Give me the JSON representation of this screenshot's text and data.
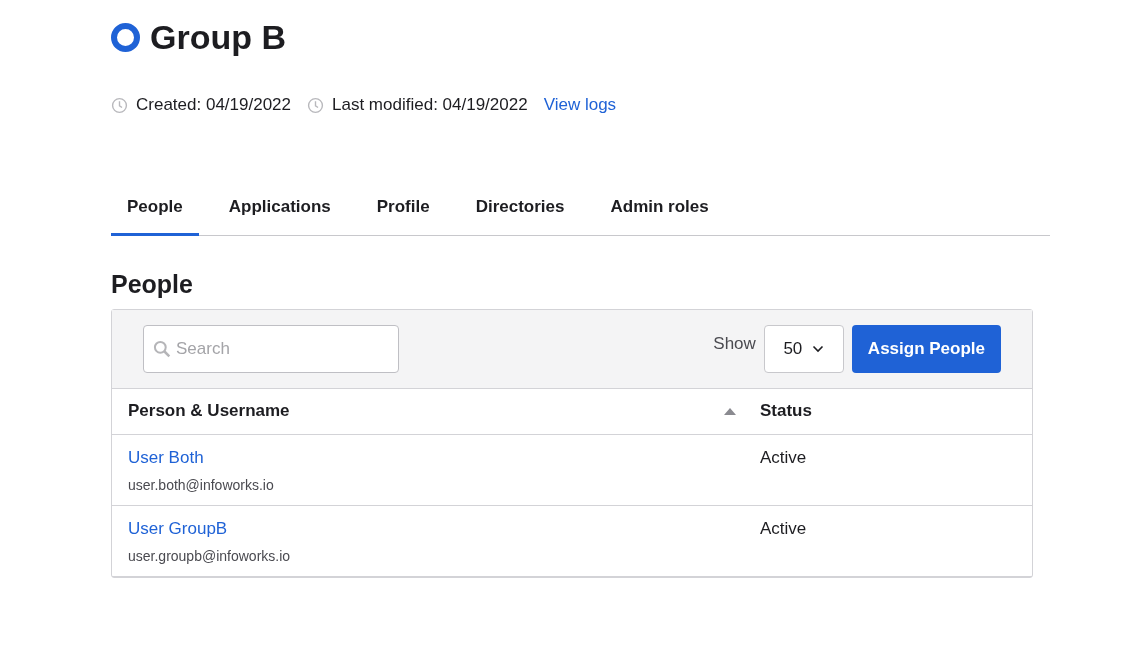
{
  "group": {
    "title": "Group B",
    "created": "Created: 04/19/2022",
    "modified": "Last modified: 04/19/2022",
    "logs_link": "View logs"
  },
  "tabs": [
    {
      "label": "People",
      "selected": true
    },
    {
      "label": "Applications",
      "selected": false
    },
    {
      "label": "Profile",
      "selected": false
    },
    {
      "label": "Directories",
      "selected": false
    },
    {
      "label": "Admin roles",
      "selected": false
    }
  ],
  "section_title": "People",
  "toolbar": {
    "search": {
      "placeholder": "Search"
    },
    "show_label": "Show",
    "page_size": "50",
    "assign_button": "Assign People"
  },
  "table": {
    "columns": [
      {
        "label": "Person & Username",
        "sorted": true
      },
      {
        "label": "Status",
        "sorted": false
      }
    ],
    "rows": [
      {
        "name": "User Both",
        "username": "user.both@infoworks.io",
        "status": "Active"
      },
      {
        "name": "User GroupB",
        "username": "user.groupb@infoworks.io",
        "status": "Active"
      }
    ]
  }
}
